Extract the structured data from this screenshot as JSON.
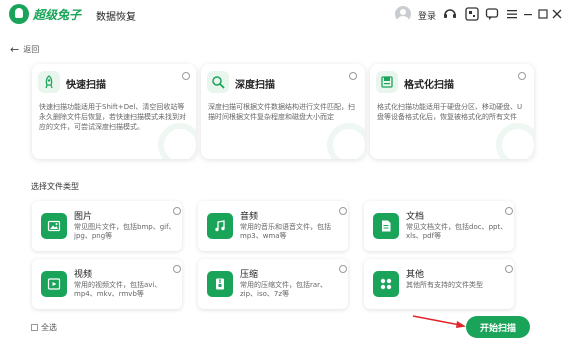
{
  "titlebar": {
    "brand": "超级兔子",
    "app_name": "数据恢复",
    "login": "登录",
    "icons": [
      "avatar-icon",
      "headset-icon",
      "qrcode-icon",
      "message-icon",
      "menu-icon",
      "minimize-icon",
      "maximize-icon",
      "close-icon"
    ]
  },
  "nav": {
    "back": "返回"
  },
  "scan_modes": [
    {
      "icon": "rocket-icon",
      "title": "快速扫描",
      "desc": "快速扫描功能适用于Shift+Del、清空回收站等永久删除文件后恢复，若快速扫描模式未找到对应的文件，可尝试深度扫描模式。"
    },
    {
      "icon": "magnifier-icon",
      "title": "深度扫描",
      "desc": "深度扫描可根据文件数据结构进行文件匹配，扫描时间根据文件复杂程度和磁盘大小而定"
    },
    {
      "icon": "format-icon",
      "title": "格式化扫描",
      "desc": "格式化扫描功能适用于硬盘分区、移动硬盘、U盘等设备格式化后，恢复被格式化的所有文件"
    }
  ],
  "section_label": "选择文件类型",
  "file_types": [
    {
      "icon": "image-icon",
      "title": "图片",
      "desc": "常见图片文件，包括bmp、gif、jpg、png等"
    },
    {
      "icon": "music-icon",
      "title": "音频",
      "desc": "常用的音乐和语音文件，包括mp3、wma等"
    },
    {
      "icon": "document-icon",
      "title": "文档",
      "desc": "常见文档文件，包括doc、ppt、xls、pdf等"
    },
    {
      "icon": "video-icon",
      "title": "视频",
      "desc": "常用的视频文件，包括avi、mp4、mkv、rmvb等"
    },
    {
      "icon": "archive-icon",
      "title": "压缩",
      "desc": "常用的压缩文件，包括rar、zip、iso、7z等"
    },
    {
      "icon": "other-icon",
      "title": "其他",
      "desc": "其他所有支持的文件类型"
    }
  ],
  "footer": {
    "select_all": "全选",
    "start_button": "开始扫描"
  },
  "colors": {
    "brand_green": "#1aa45a",
    "annotation_red": "#e0262c"
  }
}
